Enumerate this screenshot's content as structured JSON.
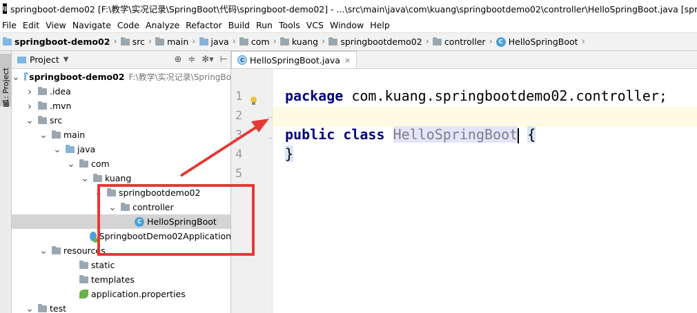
{
  "window": {
    "title": "springboot-demo02 [F:\\教学\\实况记录\\SpringBoot\\代码\\springboot-demo02] - ...\\src\\main\\java\\com\\kuang\\springbootdemo02\\controller\\HelloSpringBoot.java [springbo",
    "logo": "IJ"
  },
  "menu": [
    "File",
    "Edit",
    "View",
    "Navigate",
    "Code",
    "Analyze",
    "Refactor",
    "Build",
    "Run",
    "Tools",
    "VCS",
    "Window",
    "Help"
  ],
  "breadcrumb": [
    "springboot-demo02",
    "src",
    "main",
    "java",
    "com",
    "kuang",
    "springbootdemo02",
    "controller",
    "HelloSpringBoot"
  ],
  "side_tab": {
    "label": "1: Project"
  },
  "project_panel": {
    "title": "Project",
    "tree": [
      {
        "label": "springboot-demo02",
        "path": "F:\\教学\\实况记录\\SpringBo",
        "depth": 0,
        "arrow": "down",
        "icon": "folder-module",
        "bold": true
      },
      {
        "label": ".idea",
        "depth": 1,
        "arrow": "right",
        "icon": "folder"
      },
      {
        "label": ".mvn",
        "depth": 1,
        "arrow": "right",
        "icon": "folder"
      },
      {
        "label": "src",
        "depth": 1,
        "arrow": "down",
        "icon": "folder"
      },
      {
        "label": "main",
        "depth": 2,
        "arrow": "down",
        "icon": "folder"
      },
      {
        "label": "java",
        "depth": 3,
        "arrow": "down",
        "icon": "folder-source"
      },
      {
        "label": "com",
        "depth": 4,
        "arrow": "down",
        "icon": "folder"
      },
      {
        "label": "kuang",
        "depth": 5,
        "arrow": "down",
        "icon": "folder"
      },
      {
        "label": "springbootdemo02",
        "depth": 6,
        "arrow": "down",
        "icon": "folder"
      },
      {
        "label": "controller",
        "depth": 7,
        "arrow": "down",
        "icon": "folder"
      },
      {
        "label": "HelloSpringBoot",
        "depth": 8,
        "arrow": "",
        "icon": "class",
        "selected": true
      },
      {
        "label": "SpringbootDemo02Application",
        "depth": 7,
        "arrow": "",
        "icon": "app-class"
      },
      {
        "label": "resources",
        "depth": 2,
        "arrow": "down",
        "icon": "folder"
      },
      {
        "label": "static",
        "depth": 4,
        "arrow": "",
        "icon": "folder"
      },
      {
        "label": "templates",
        "depth": 4,
        "arrow": "",
        "icon": "folder"
      },
      {
        "label": "application.properties",
        "depth": 4,
        "arrow": "",
        "icon": "spring"
      },
      {
        "label": "test",
        "depth": 1,
        "arrow": "down",
        "icon": "folder"
      }
    ]
  },
  "editor": {
    "tab": "HelloSpringBoot.java",
    "line_numbers": [
      "1",
      "2",
      "3",
      "4",
      "5"
    ],
    "code": {
      "line1_kw": "package",
      "line1_rest": " com.kuang.springbootdemo02.controller;",
      "line3_kw1": "public",
      "line3_kw2": "class",
      "line3_class": "HelloSpringBoot",
      "line3_brace": "{",
      "line4": "}"
    }
  },
  "colors": {
    "annotation": "#e53935",
    "keyword": "#000080",
    "selection": "#d4d4d4"
  }
}
